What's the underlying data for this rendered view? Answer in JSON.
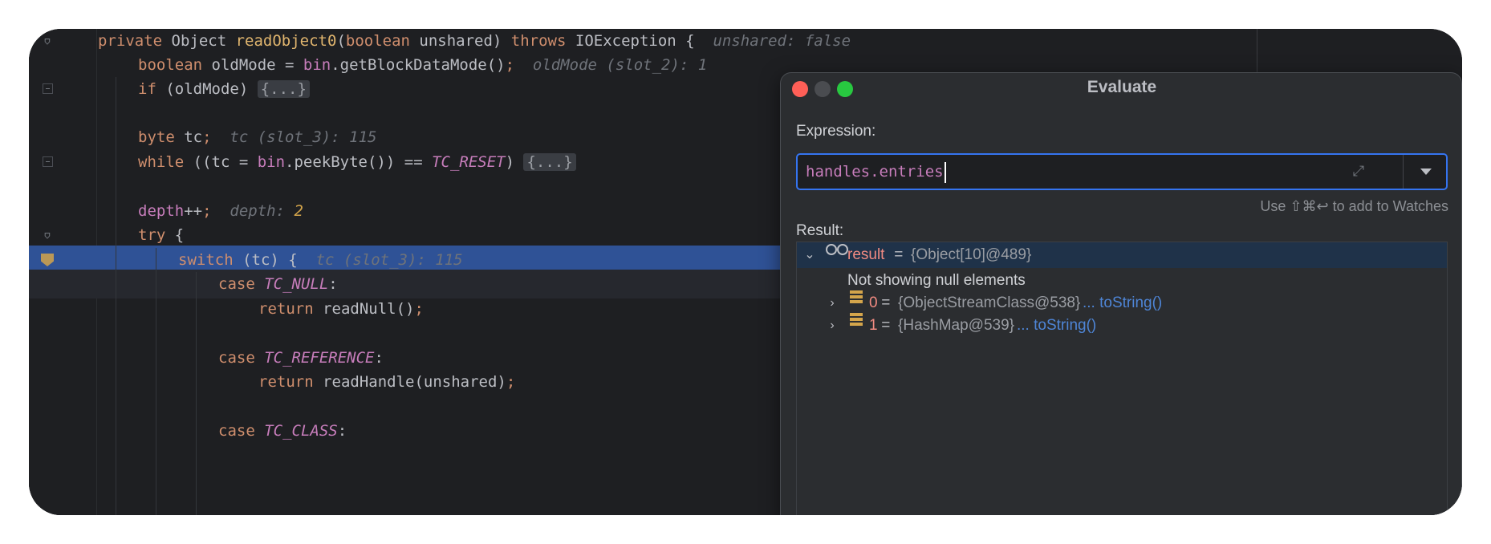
{
  "editor": {
    "lines": [
      {
        "id": "l1",
        "segments": [
          [
            "kw",
            "private "
          ],
          [
            "plain",
            "Object "
          ],
          [
            "mt",
            "readObject0"
          ],
          [
            "plain",
            "("
          ],
          [
            "kw",
            "boolean "
          ],
          [
            "plain",
            "unshared) "
          ],
          [
            "kw",
            "throws "
          ],
          [
            "plain",
            "IOException {  "
          ],
          [
            "hint",
            "unshared: false"
          ]
        ]
      },
      {
        "id": "l2",
        "segments": [
          [
            "kw",
            "boolean "
          ],
          [
            "plain",
            "oldMode = "
          ],
          [
            "fld",
            "bin"
          ],
          [
            "plain",
            ".getBlockDataMode()"
          ],
          [
            "kw",
            ";  "
          ],
          [
            "hint",
            "oldMode (slot_2): 1"
          ]
        ]
      },
      {
        "id": "l3",
        "segments": [
          [
            "kw",
            "if "
          ],
          [
            "plain",
            "(oldMode) "
          ],
          [
            "foldtxt",
            "{...}"
          ]
        ]
      },
      {
        "id": "l4",
        "segments": []
      },
      {
        "id": "l5",
        "segments": [
          [
            "kw",
            "byte "
          ],
          [
            "plain",
            "tc"
          ],
          [
            "kw",
            ";  "
          ],
          [
            "hint",
            "tc (slot_3): 115"
          ]
        ]
      },
      {
        "id": "l6",
        "segments": [
          [
            "kw",
            "while "
          ],
          [
            "plain",
            "((tc = "
          ],
          [
            "fld",
            "bin"
          ],
          [
            "plain",
            ".peekByte()) == "
          ],
          [
            "cst",
            "TC_RESET"
          ],
          [
            "plain",
            ") "
          ],
          [
            "foldtxt",
            "{...}"
          ]
        ]
      },
      {
        "id": "l7",
        "segments": []
      },
      {
        "id": "l8",
        "segments": [
          [
            "fld",
            "depth"
          ],
          [
            "plain",
            "++"
          ],
          [
            "kw",
            ";  "
          ],
          [
            "hint",
            "depth: "
          ],
          [
            "hint-num",
            "2"
          ]
        ]
      },
      {
        "id": "l9",
        "segments": [
          [
            "kw",
            "try "
          ],
          [
            "plain",
            "{"
          ]
        ]
      },
      {
        "id": "l10",
        "segments": [
          [
            "kw",
            "switch "
          ],
          [
            "plain",
            "(tc) {  "
          ],
          [
            "hint",
            "tc (slot_3): 115"
          ]
        ]
      },
      {
        "id": "l11",
        "segments": [
          [
            "kw",
            "case "
          ],
          [
            "cst",
            "TC_NULL"
          ],
          [
            "plain",
            ":"
          ]
        ]
      },
      {
        "id": "l12",
        "segments": [
          [
            "kw",
            "return "
          ],
          [
            "plain",
            "readNull()"
          ],
          [
            "kw",
            ";"
          ]
        ]
      },
      {
        "id": "l13",
        "segments": []
      },
      {
        "id": "l14",
        "segments": [
          [
            "kw",
            "case "
          ],
          [
            "cst",
            "TC_REFERENCE"
          ],
          [
            "plain",
            ":"
          ]
        ]
      },
      {
        "id": "l15",
        "segments": [
          [
            "kw",
            "return "
          ],
          [
            "plain",
            "readHandle(unshared)"
          ],
          [
            "kw",
            ";"
          ]
        ]
      },
      {
        "id": "l16",
        "segments": []
      },
      {
        "id": "l17",
        "segments": [
          [
            "kw",
            "case "
          ],
          [
            "cst",
            "TC_CLASS"
          ],
          [
            "plain",
            ":"
          ]
        ]
      }
    ]
  },
  "dialog": {
    "title": "Evaluate",
    "expression_label": "Expression:",
    "expression_value": "handles.entries",
    "watch_hint": "Use ⇧⌘↩ to add to Watches",
    "result_label": "Result:",
    "tree": {
      "root": {
        "name": "result",
        "eq": " = ",
        "value": "{Object[10]@489}"
      },
      "note": "Not showing null elements",
      "children": [
        {
          "name": "0",
          "eq": " = ",
          "value": "{ObjectStreamClass@538}",
          "link": "... toString()"
        },
        {
          "name": "1",
          "eq": " = ",
          "value": "{HashMap@539}",
          "link": "... toString()"
        }
      ]
    }
  },
  "colors": {
    "background": "#1e1f22",
    "execution_line": "#2f5296",
    "keyword": "#cf8e6d",
    "method": "#e0b56e",
    "field": "#c77dbb",
    "accent": "#3574f0"
  }
}
